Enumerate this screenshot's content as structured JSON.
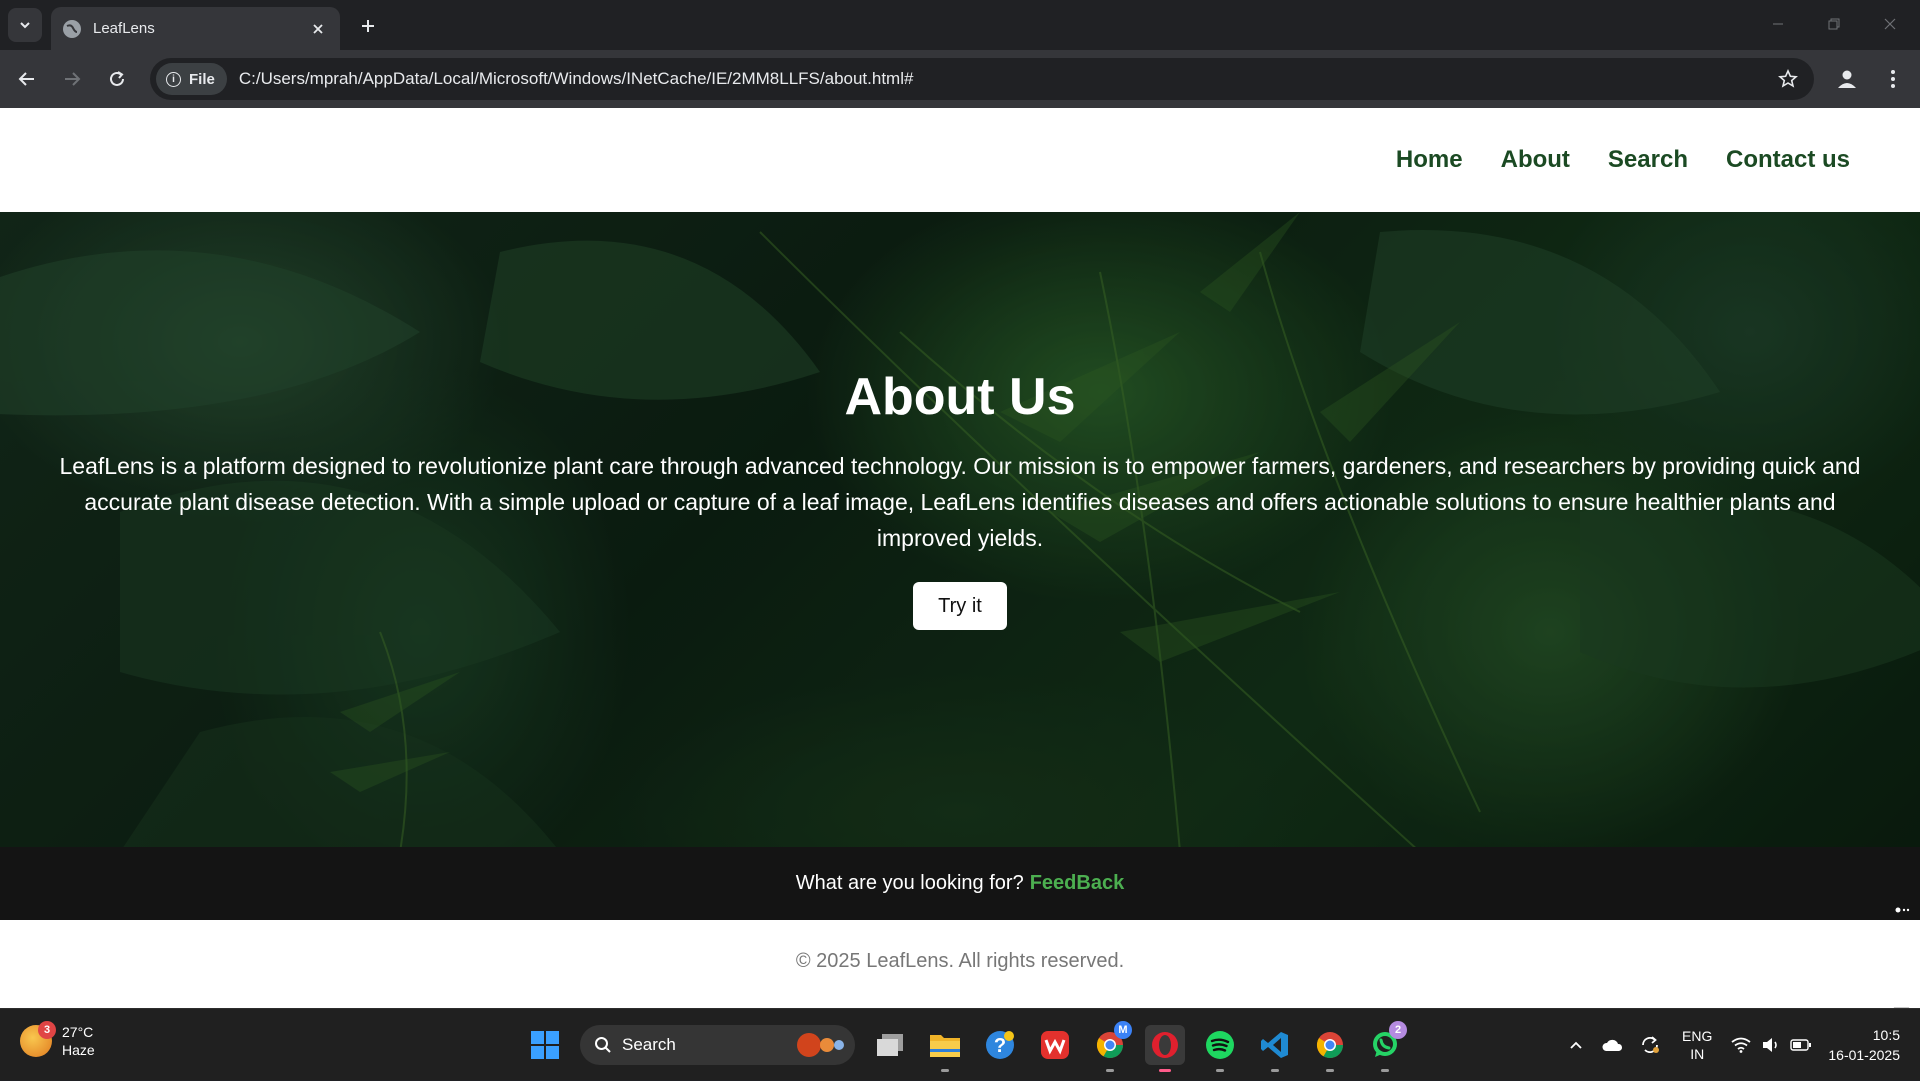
{
  "browser": {
    "tab_title": "LeafLens",
    "site_chip_label": "File",
    "url": "C:/Users/mprah/AppData/Local/Microsoft/Windows/INetCache/IE/2MM8LLFS/about.html#"
  },
  "site": {
    "nav": [
      "Home",
      "About",
      "Search",
      "Contact us"
    ],
    "hero_title": "About Us",
    "hero_text": "LeafLens is a platform designed to revolutionize plant care through advanced technology. Our mission is to empower farmers, gardeners, and researchers by providing quick and accurate plant disease detection. With a simple upload or capture of a leaf image, LeafLens identifies diseases and offers actionable solutions to ensure healthier plants and improved yields.",
    "try_button": "Try it",
    "feedback_prompt": "What are you looking for?",
    "feedback_link": "FeedBack",
    "copyright": "© 2025 LeafLens. All rights reserved."
  },
  "taskbar": {
    "weather_temp": "27°C",
    "weather_desc": "Haze",
    "weather_badge": "3",
    "search_label": "Search",
    "whatsapp_badge": "2",
    "chrome_badge": "M",
    "lang_top": "ENG",
    "lang_bottom": "IN",
    "time": "10:5",
    "date": "16-01-2025"
  },
  "colors": {
    "nav_text": "#1b4a23",
    "feedback_link": "#4caf50",
    "footer_dark": "#141414"
  }
}
